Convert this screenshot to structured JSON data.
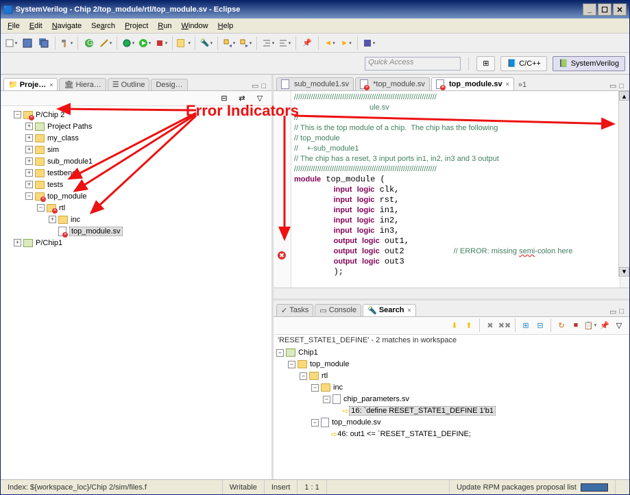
{
  "window": {
    "title": "SystemVerilog - Chip 2/top_module/rtl/top_module.sv - Eclipse"
  },
  "menus": [
    "File",
    "Edit",
    "Navigate",
    "Search",
    "Project",
    "Run",
    "Window",
    "Help"
  ],
  "quick_access_placeholder": "Quick Access",
  "perspectives": [
    {
      "label": "C/C++"
    },
    {
      "label": "SystemVerilog"
    }
  ],
  "left_tabs": [
    {
      "label": "Proje…",
      "active": true
    },
    {
      "label": "Hiera…",
      "active": false
    },
    {
      "label": "Outline",
      "active": false
    },
    {
      "label": "Desig…",
      "active": false
    }
  ],
  "project_tree": {
    "root1": {
      "label": "P/Chip 2",
      "err": true
    },
    "paths": "Project Paths",
    "my_class": "my_class",
    "sim": "sim",
    "sub_module1": "sub_module1",
    "testbench": "testbench",
    "tests": "tests",
    "top_module": {
      "label": "top_module",
      "err": true
    },
    "rtl": {
      "label": "rtl",
      "err": true
    },
    "inc": "inc",
    "top_module_sv": {
      "label": "top_module.sv",
      "err": true
    },
    "root2": "P/Chip1"
  },
  "editor_tabs": [
    {
      "label": "sub_module1.sv",
      "dirty": false,
      "active": false,
      "err": false
    },
    {
      "label": "*top_module.sv",
      "dirty": true,
      "active": false,
      "err": true
    },
    {
      "label": "top_module.sv",
      "dirty": false,
      "active": true,
      "err": true
    }
  ],
  "editor_extra": "»1",
  "code_lines": [
    {
      "t": "cm",
      "s": "////////////////////////////////////////////////////////////////////"
    },
    {
      "t": "cm",
      "s": "                                    ule.sv"
    },
    {
      "t": "cm",
      "s": "//"
    },
    {
      "t": "cm",
      "s": "// This is the top module of a chip.  The chip has the following"
    },
    {
      "t": "cm",
      "s": "// top_module"
    },
    {
      "t": "cm",
      "s": "//    +-sub_module1"
    },
    {
      "t": "cm",
      "s": "// The chip has a reset, 3 input ports in1, in2, in3 and 3 output"
    },
    {
      "t": "cm",
      "s": "////////////////////////////////////////////////////////////////////"
    },
    {
      "t": "mod",
      "s": "module top_module ("
    },
    {
      "t": "port",
      "s": "        input logic clk,"
    },
    {
      "t": "port",
      "s": "        input logic rst,"
    },
    {
      "t": "port",
      "s": "        input logic in1,"
    },
    {
      "t": "port",
      "s": "        input logic in2,"
    },
    {
      "t": "port",
      "s": "        input logic in3,"
    },
    {
      "t": "port",
      "s": "        output logic out1,"
    },
    {
      "t": "porterr",
      "s": "        output logic out2          // ERROR: missing semi-colon here"
    },
    {
      "t": "port",
      "s": "        output logic out3"
    },
    {
      "t": "plain",
      "s": "        );"
    },
    {
      "t": "plain",
      "s": ""
    },
    {
      "t": "cm",
      "s": "////////////////////////////////////////////////////////////////////"
    }
  ],
  "bottom_tabs": [
    {
      "label": "Tasks",
      "active": false
    },
    {
      "label": "Console",
      "active": false
    },
    {
      "label": "Search",
      "active": true
    }
  ],
  "search": {
    "summary": "'RESET_STATE1_DEFINE' - 2 matches in workspace",
    "chip": "Chip1",
    "top_module": "top_module",
    "rtl": "rtl",
    "inc": "inc",
    "chip_params": "chip_parameters.sv",
    "line16": "16: `define RESET_STATE1_DEFINE 1'b1",
    "top_sv": "top_module.sv",
    "line46": "46: out1 <= `RESET_STATE1_DEFINE;"
  },
  "status": {
    "index": "Index: ${workspace_loc}/Chip 2/sim/files.f",
    "writable": "Writable",
    "insert": "Insert",
    "pos": "1 : 1",
    "update": "Update RPM packages proposal list"
  },
  "annotation": "Error Indicators"
}
